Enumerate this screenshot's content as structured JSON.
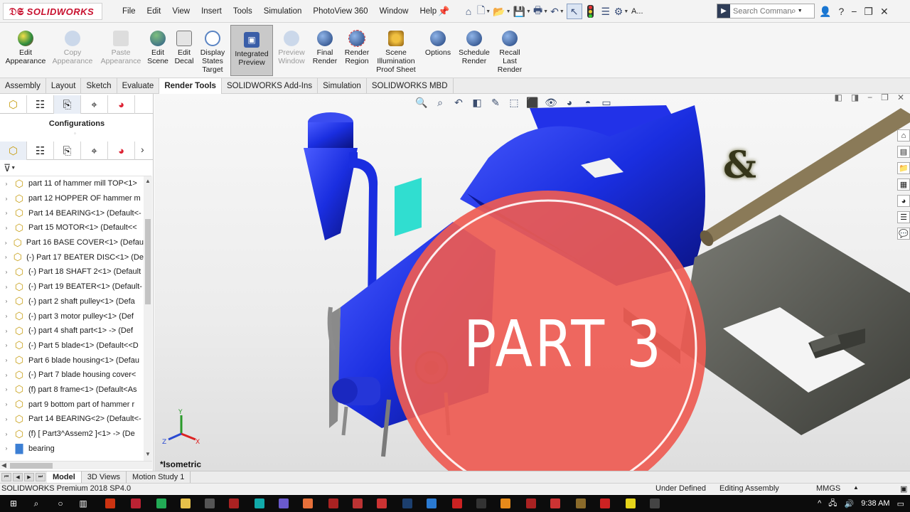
{
  "app": {
    "logo_text": "SOLIDWORKS",
    "logo_mark": "3DS"
  },
  "menu": [
    "File",
    "Edit",
    "View",
    "Insert",
    "Tools",
    "Simulation",
    "PhotoView 360",
    "Window",
    "Help"
  ],
  "search": {
    "placeholder": "Search Commands"
  },
  "quick_access_icons": [
    "home-icon",
    "new-document-icon",
    "open-folder-icon",
    "save-icon",
    "print-icon",
    "undo-icon",
    "select-arrow-icon",
    "rebuild-traffic-light-icon",
    "file-properties-icon",
    "options-gear-icon"
  ],
  "quick_access_trailing": "A...",
  "ribbon": [
    {
      "label": "Edit\nAppearance",
      "enabled": true,
      "icon": "appearance-ball-icon",
      "color": "#2a8a3e"
    },
    {
      "label": "Copy\nAppearance",
      "enabled": false,
      "icon": "copy-appearance-icon",
      "color": "#4a7bc8"
    },
    {
      "label": "Paste\nAppearance",
      "enabled": false,
      "icon": "paste-appearance-icon",
      "color": "#7a7a7a"
    },
    {
      "label": "Edit\nScene",
      "enabled": true,
      "icon": "scene-icon",
      "color": "#3f8a4f"
    },
    {
      "label": "Edit\nDecal",
      "enabled": true,
      "icon": "decal-icon",
      "color": "#6b6b6b"
    },
    {
      "label": "Display\nStates\nTarget",
      "enabled": true,
      "icon": "display-states-icon",
      "color": "#5a84c3"
    },
    {
      "label": "Integrated\nPreview",
      "enabled": true,
      "active": true,
      "icon": "integrated-preview-icon",
      "color": "#3a5ea8"
    },
    {
      "label": "Preview\nWindow",
      "enabled": false,
      "icon": "preview-window-icon",
      "color": "#7a9ac8"
    },
    {
      "label": "Final\nRender",
      "enabled": true,
      "icon": "final-render-icon",
      "color": "#2c5e9e"
    },
    {
      "label": "Render\nRegion",
      "enabled": true,
      "icon": "render-region-icon",
      "color": "#3b6aa8"
    },
    {
      "label": "Scene\nIllumination\nProof Sheet",
      "enabled": true,
      "icon": "proof-sheet-icon",
      "color": "#c88a1a"
    },
    {
      "label": "Options",
      "enabled": true,
      "icon": "options-icon",
      "color": "#2c5e9e"
    },
    {
      "label": "Schedule\nRender",
      "enabled": true,
      "icon": "schedule-render-icon",
      "color": "#3b6aa8"
    },
    {
      "label": "Recall\nLast\nRender",
      "enabled": true,
      "icon": "recall-render-icon",
      "color": "#2c5e9e"
    }
  ],
  "tabs": [
    {
      "label": "Assembly",
      "active": false
    },
    {
      "label": "Layout",
      "active": false
    },
    {
      "label": "Sketch",
      "active": false
    },
    {
      "label": "Evaluate",
      "active": false
    },
    {
      "label": "Render Tools",
      "active": true
    },
    {
      "label": "SOLIDWORKS Add-Ins",
      "active": false
    },
    {
      "label": "Simulation",
      "active": false
    },
    {
      "label": "SOLIDWORKS MBD",
      "active": false
    }
  ],
  "feature_manager": {
    "panel_title": "Configurations",
    "tree": [
      "part 11 of hammer mill TOP<1>",
      "part 12 HOPPER OF hammer m",
      "Part 14 BEARING<1> (Default<-",
      "Part 15 MOTOR<1> (Default<<",
      "Part 16 BASE COVER<1> (Defau",
      "(-) Part 17 BEATER DISC<1> (De",
      "(-) Part 18 SHAFT 2<1> (Default",
      "(-) Part 19 BEATER<1> (Default-",
      "(-) part 2 shaft pulley<1> (Defa",
      "(-) part 3 motor pulley<1> (Def",
      "(-) part 4 shaft part<1> -> (Def",
      "(-) Part 5 blade<1> (Default<<D",
      "Part 6 blade housing<1> (Defau",
      "(-) Part 7 blade housing cover<",
      "(f) part 8 frame<1> (Default<As",
      "part 9 bottom part of hammer r",
      "Part 14 BEARING<2> (Default<-",
      "(f) [ Part3^Assem2 ]<1> -> (De",
      "bearing"
    ]
  },
  "viewport": {
    "view_label": "*Isometric",
    "overlay_text": "PART 3",
    "overlay_symbol": "&",
    "overlay_color": "#ee5b52",
    "model_color": "#1a2ee0",
    "hopper_color": "#55564f",
    "accent_color": "#2fd8c8",
    "triad_labels": [
      "Y",
      "X",
      "Z"
    ]
  },
  "model_tabs": [
    {
      "label": "Model",
      "active": true
    },
    {
      "label": "3D Views",
      "active": false
    },
    {
      "label": "Motion Study 1",
      "active": false
    }
  ],
  "status_bar": {
    "product": "SOLIDWORKS Premium 2018 SP4.0",
    "state": "Under Defined",
    "mode": "Editing Assembly",
    "units": "MMGS"
  },
  "taskbar": {
    "time": "9:38 AM"
  }
}
